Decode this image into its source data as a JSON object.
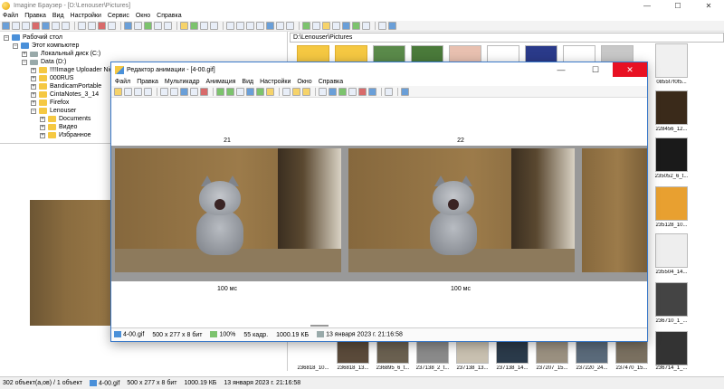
{
  "app": {
    "title": "Imagine Браузер - [D:\\Lenouser\\Pictures]"
  },
  "menu": [
    "Файл",
    "Правка",
    "Вид",
    "Настройки",
    "Сервис",
    "Окно",
    "Справка"
  ],
  "tree": {
    "items": [
      {
        "label": "Рабочий стол",
        "icon": "folder-icon"
      },
      {
        "label": "Этот компьютер",
        "icon": "computer-icon"
      },
      {
        "label": "Локальный диск (C:)",
        "icon": "drive-icon"
      },
      {
        "label": "Data (D:)",
        "icon": "drive-icon"
      },
      {
        "label": "!!!!Image Uploader Nigtly",
        "icon": "folder-icon"
      },
      {
        "label": "000RUS",
        "icon": "folder-icon"
      },
      {
        "label": "BandicamPortable",
        "icon": "folder-icon"
      },
      {
        "label": "CintaNotes_3_14",
        "icon": "folder-icon"
      },
      {
        "label": "Firefox",
        "icon": "folder-icon"
      },
      {
        "label": "Lenouser",
        "icon": "folder-icon"
      },
      {
        "label": "Documents",
        "icon": "folder-icon"
      },
      {
        "label": "Видео",
        "icon": "folder-icon"
      },
      {
        "label": "Избранное",
        "icon": "folder-icon"
      }
    ]
  },
  "browser": {
    "path": "D:\\Lenouser\\Pictures",
    "right_labels": [
      "0855f7f0f5...",
      "228456_12...",
      "235052_6_t...",
      "235128_10...",
      "235504_14...",
      "236710_1_...",
      "236714_1_..."
    ],
    "bottom_labels": [
      "236818_10...",
      "236818_13...",
      "236895_6_t...",
      "237138_2_t...",
      "237138_13...",
      "237138_14...",
      "237207_15...",
      "237220_24...",
      "237470_15..."
    ]
  },
  "status": {
    "count": "302 объект(а,ов) / 1 объект",
    "file": "4-00.gif",
    "dims": "500 x 277 x 8 бит",
    "size": "1000.19 КБ",
    "date": "13 января 2023 г. 21:16:58"
  },
  "dialog": {
    "title": "Редактор анимации - [4-00.gif]",
    "menu": [
      "Файл",
      "Правка",
      "Мультикадр",
      "Анимация",
      "Вид",
      "Настройки",
      "Окно",
      "Справка"
    ],
    "frames": [
      {
        "number": "21",
        "duration": "100 мс"
      },
      {
        "number": "22",
        "duration": "100 мс"
      }
    ],
    "status": {
      "file": "4-00.gif",
      "dims": "500 x 277 x 8 бит",
      "zoom": "100%",
      "frames": "55 кадр.",
      "size": "1000.19 КБ",
      "date": "13 января 2023 г. 21:16:58"
    }
  },
  "colors": {
    "accent": "#3a79c9",
    "close": "#e81123",
    "folder": "#f5c842"
  }
}
